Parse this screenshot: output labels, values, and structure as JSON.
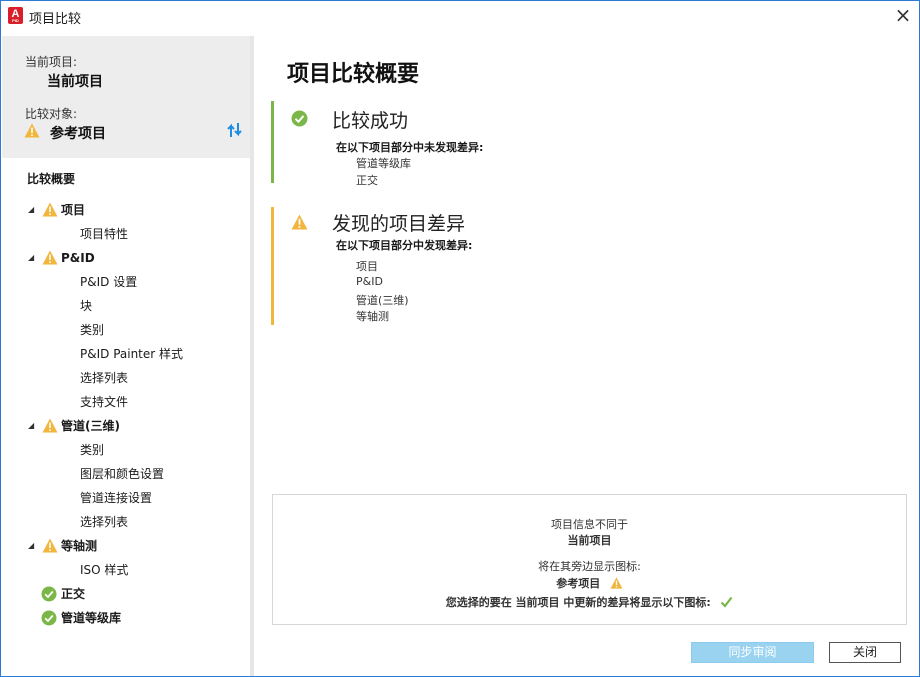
{
  "window": {
    "title": "项目比较",
    "app_icon_letter": "A",
    "app_icon_sub": "PID"
  },
  "left": {
    "current_label": "当前项目:",
    "current_value": "当前项目",
    "compare_label": "比较对象:",
    "compare_value": "参考项目",
    "summary_title": "比较概要",
    "tree": {
      "project": {
        "label": "项目",
        "children": [
          "项目特性"
        ]
      },
      "pid": {
        "label": "P&ID",
        "children": [
          "P&ID 设置",
          "块",
          "类别",
          "P&ID Painter 样式",
          "选择列表",
          "支持文件"
        ]
      },
      "piping3d": {
        "label": "管道(三维)",
        "children": [
          "类别",
          "图层和颜色设置",
          "管道连接设置",
          "选择列表"
        ]
      },
      "iso": {
        "label": "等轴测",
        "children": [
          "ISO 样式"
        ]
      },
      "ortho": {
        "label": "正交"
      },
      "specs": {
        "label": "管道等级库"
      }
    }
  },
  "main": {
    "title": "项目比较概要",
    "success": {
      "title": "比较成功",
      "sub": "在以下项目部分中未发现差异:",
      "items": [
        "管道等级库",
        "正交"
      ]
    },
    "diff": {
      "title": "发现的项目差异",
      "sub": "在以下项目部分中发现差异:",
      "items": [
        "项目",
        "P&ID",
        "管道(三维)",
        "等轴测"
      ]
    },
    "info": {
      "line1": "项目信息不同于",
      "line2": "当前项目",
      "line3": "将在其旁边显示图标:",
      "line4": "参考项目",
      "line5": "您选择的要在 当前项目 中更新的差异将显示以下图标:"
    }
  },
  "buttons": {
    "sync": "同步审阅",
    "close": "关闭"
  },
  "colors": {
    "success": "#7ab648",
    "warning": "#f0b63e",
    "accent": "#2b7bd6"
  }
}
